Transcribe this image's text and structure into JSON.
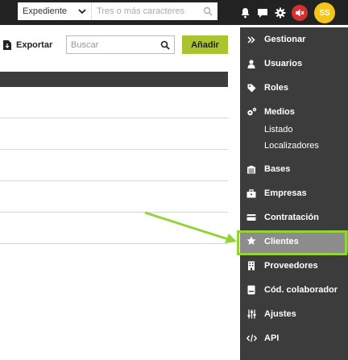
{
  "header": {
    "search_type": "Expediente",
    "search_placeholder": "Tres o más caracteres",
    "avatar_initials": "SS"
  },
  "toolbar": {
    "export_label": "Exportar",
    "filter_placeholder": "Buscar",
    "add_label": "Añadir"
  },
  "menu": {
    "items": [
      {
        "label": "Gestionar",
        "icon": "double-chevron-right-icon"
      },
      {
        "label": "Usuarios",
        "icon": "user-icon"
      },
      {
        "label": "Roles",
        "icon": "tag-icon"
      },
      {
        "label": "Medios",
        "icon": "gears-icon"
      },
      {
        "label": "Bases",
        "icon": "archive-icon"
      },
      {
        "label": "Empresas",
        "icon": "briefcase-icon"
      },
      {
        "label": "Contratación",
        "icon": "credit-card-icon"
      },
      {
        "label": "Clientes",
        "icon": "star-icon"
      },
      {
        "label": "Proveedores",
        "icon": "building-icon"
      },
      {
        "label": "Cód. colaborador",
        "icon": "id-book-icon"
      },
      {
        "label": "Ajustes",
        "icon": "sliders-icon"
      },
      {
        "label": "API",
        "icon": "code-icon"
      }
    ],
    "medios_sub": [
      "Listado",
      "Localizadores"
    ],
    "active": "Clientes"
  },
  "colors": {
    "topbar": "#222222",
    "menu_bg": "#3c3c3c",
    "active_item": "#8c8c8c",
    "accent_green": "#a8c530",
    "highlight_green": "#93d337",
    "avatar_yellow": "#f5c518",
    "mute_red": "#d62f2f"
  }
}
